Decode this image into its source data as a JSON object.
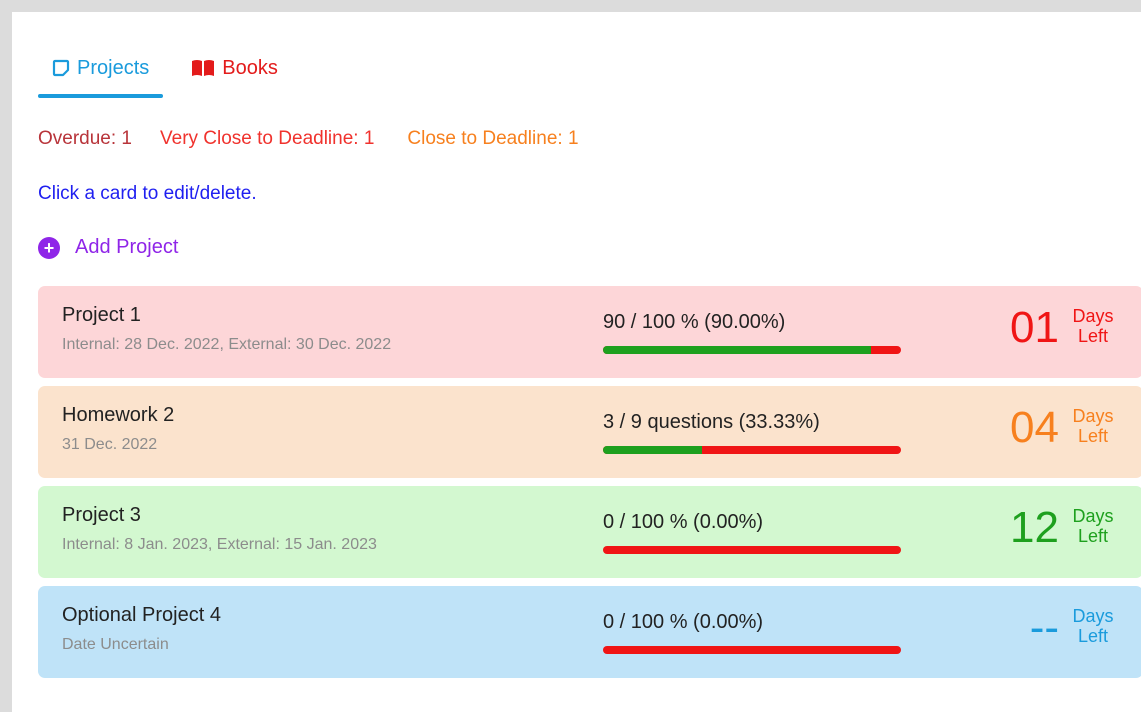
{
  "tabs": [
    {
      "label": "Projects",
      "icon": "sticky-note-icon",
      "color": "#1a9bdc",
      "active": true
    },
    {
      "label": "Books",
      "icon": "open-book-icon",
      "color": "#e31b1b",
      "active": false
    }
  ],
  "status": {
    "overdue": "Overdue: 1",
    "very_close": "Very Close to Deadline: 1",
    "close": "Close to Deadline: 1"
  },
  "hint": "Click a card to edit/delete.",
  "add_project": {
    "label": "Add Project",
    "icon": "plus-circle-icon"
  },
  "cards": [
    {
      "title": "Project 1",
      "dates": "Internal: 28 Dec. 2022, External: 30 Dec. 2022",
      "progress_text": "90 / 100 % (90.00%)",
      "progress": 0.9,
      "days": "01",
      "days_label_1": "Days",
      "days_label_2": "Left",
      "bg": "#fdd6d8",
      "accent": "#f01515"
    },
    {
      "title": "Homework 2",
      "dates": "31 Dec. 2022",
      "progress_text": "3 / 9 questions (33.33%)",
      "progress": 0.3333,
      "days": "04",
      "days_label_1": "Days",
      "days_label_2": "Left",
      "bg": "#fbe3cd",
      "accent": "#f7801e"
    },
    {
      "title": "Project 3",
      "dates": "Internal: 8 Jan. 2023, External: 15 Jan. 2023",
      "progress_text": "0 / 100 % (0.00%)",
      "progress": 0,
      "days": "12",
      "days_label_1": "Days",
      "days_label_2": "Left",
      "bg": "#d3f8d0",
      "accent": "#1ea01e"
    },
    {
      "title": "Optional Project 4",
      "dates": "Date Uncertain",
      "progress_text": "0 / 100 % (0.00%)",
      "progress": 0,
      "days": "--",
      "days_label_1": "Days",
      "days_label_2": "Left",
      "bg": "#bfe3f8",
      "accent": "#1a9bdc"
    }
  ]
}
